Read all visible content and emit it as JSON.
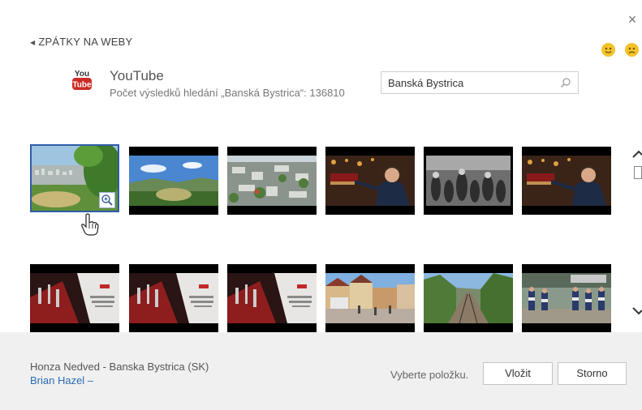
{
  "dialog": {
    "back_label": "ZPÁTKY NA WEBY",
    "close_glyph": "×"
  },
  "provider": {
    "logo_text_top": "You",
    "logo_text_bottom": "Tube",
    "name": "YouTube",
    "result_count": "Počet výsledků hledání „Banská Bystrica“: 136810"
  },
  "search": {
    "value": "Banská Bystrica"
  },
  "results": [
    {
      "id": 1,
      "selected": true,
      "scene": "city-aerial-trees"
    },
    {
      "id": 2,
      "selected": false,
      "scene": "landscape-sky"
    },
    {
      "id": 3,
      "selected": false,
      "scene": "city-aerial"
    },
    {
      "id": 4,
      "selected": false,
      "scene": "speaker-red"
    },
    {
      "id": 5,
      "selected": false,
      "scene": "crowd-bw"
    },
    {
      "id": 6,
      "selected": false,
      "scene": "speaker-red"
    },
    {
      "id": 7,
      "selected": false,
      "scene": "news-red"
    },
    {
      "id": 8,
      "selected": false,
      "scene": "news-red"
    },
    {
      "id": 9,
      "selected": false,
      "scene": "news-red"
    },
    {
      "id": 10,
      "selected": false,
      "scene": "town-square"
    },
    {
      "id": 11,
      "selected": false,
      "scene": "railway-valley"
    },
    {
      "id": 12,
      "selected": false,
      "scene": "event-people"
    }
  ],
  "footer": {
    "title": "Honza Nedved - Banska Bystrica (SK)",
    "author": "Brian Hazel –",
    "status": "Vyberte položku.",
    "insert_label": "Vložit",
    "cancel_label": "Storno"
  },
  "colors": {
    "selection_border": "#2e5da8",
    "youtube_red": "#cc2c26",
    "link_blue": "#2b6cb3",
    "smiley_yellow": "#f2c22b"
  },
  "icons": [
    "close-icon",
    "back-arrow-icon",
    "smile-icon",
    "frown-icon",
    "youtube-logo",
    "search-icon",
    "zoom-in-icon",
    "hand-cursor-icon",
    "chevron-up-icon",
    "chevron-down-icon"
  ]
}
